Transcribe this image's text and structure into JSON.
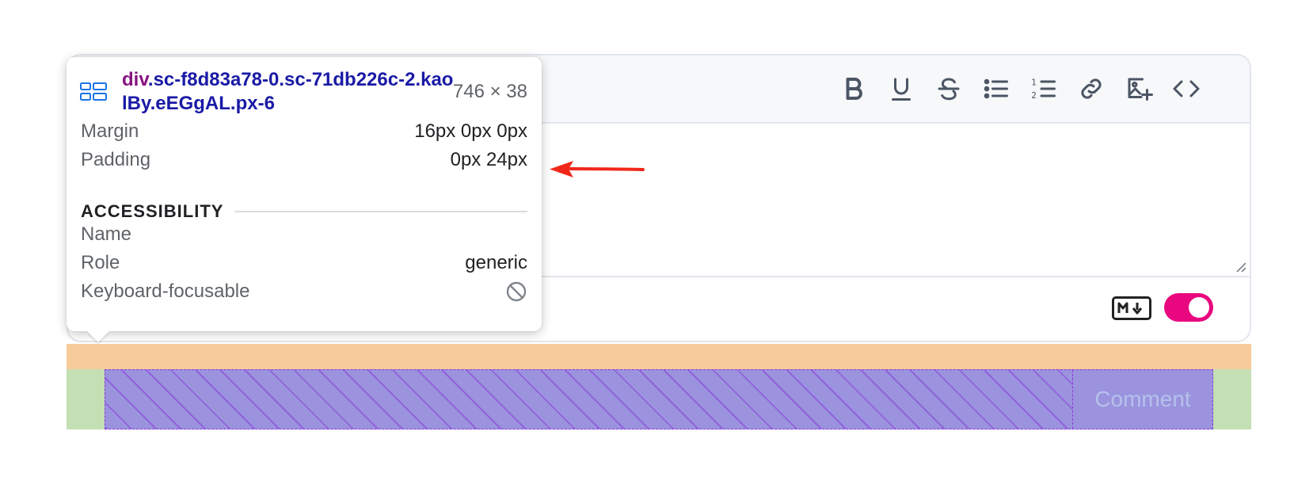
{
  "tooltip": {
    "tag": "div",
    "selector": ".sc-f8d83a78-0.sc-71db226c-2.kaolBy.eEGgAL.px-6",
    "dimensions": "746 × 38",
    "margin_label": "Margin",
    "margin_value": "16px 0px 0px",
    "padding_label": "Padding",
    "padding_value": "0px 24px",
    "accessibility_heading": "ACCESSIBILITY",
    "name_label": "Name",
    "name_value": "",
    "role_label": "Role",
    "role_value": "generic",
    "keyboard_label": "Keyboard-focusable",
    "keyboard_icon": "not-allowed-icon"
  },
  "toolbar": {
    "buttons": [
      "bold",
      "underline",
      "strikethrough",
      "bullet-list",
      "numbered-list",
      "link",
      "image",
      "code"
    ]
  },
  "footer": {
    "markdown_badge_icon": "markdown-icon",
    "toggle_on": true
  },
  "comment_button": "Comment",
  "colors": {
    "accent_toggle": "#e8077e",
    "margin_overlay": "#f8cb9b",
    "padding_overlay": "#c3dfb3",
    "content_overlay": "#9b93de",
    "selector_text": "#1a1aa6",
    "tag_text": "#881280",
    "annotation_arrow": "#f0281a"
  }
}
